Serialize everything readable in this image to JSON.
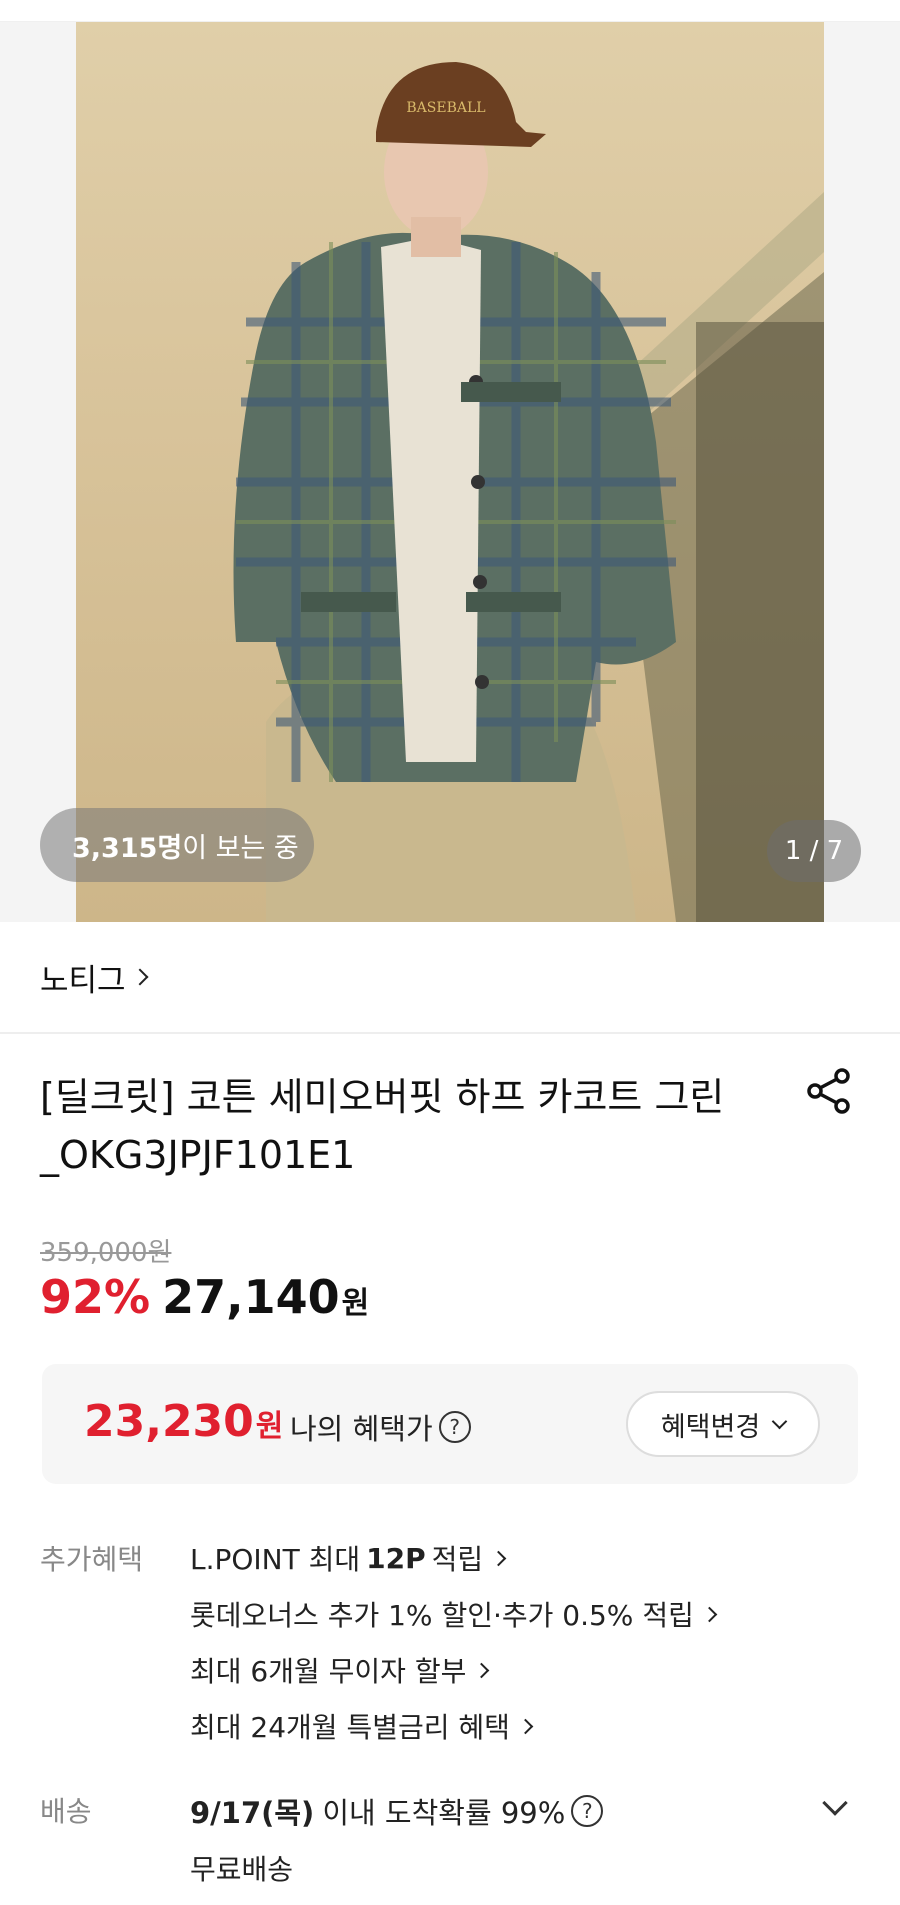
{
  "hero": {
    "image_alt": "product-photo",
    "viewers_count": "3,315명",
    "viewers_suffix": "이 보는 중",
    "counter": "1 / 7"
  },
  "brand": {
    "name": "노티그"
  },
  "product": {
    "title": "[딜크릿] 코튼 세미오버핏 하프 카코트 그린 _OKG3JPJF101E1"
  },
  "price": {
    "original": "359,000원",
    "discount_rate": "92%",
    "sale": "27,140",
    "currency": "원"
  },
  "benefit_box": {
    "price": "23,230",
    "currency": "원",
    "label": "나의 혜택가",
    "help_icon": "?",
    "change_button": "혜택변경"
  },
  "extra_benefits": {
    "label": "추가혜택",
    "items": [
      {
        "pre": "L.POINT 최대 ",
        "bold": "12P",
        "post": " 적립"
      },
      {
        "text": "롯데오너스 추가 1% 할인·추가 0.5% 적립"
      },
      {
        "text": "최대 6개월 무이자 할부"
      },
      {
        "text": "최대 24개월 특별금리 혜택"
      }
    ]
  },
  "delivery": {
    "label": "배송",
    "date": "9/17(목)",
    "probability": "이내 도착확률 99%",
    "help_icon": "?",
    "fee": "무료배송"
  },
  "colors": {
    "accent_red": "#e0202f",
    "muted_text": "#888888"
  }
}
